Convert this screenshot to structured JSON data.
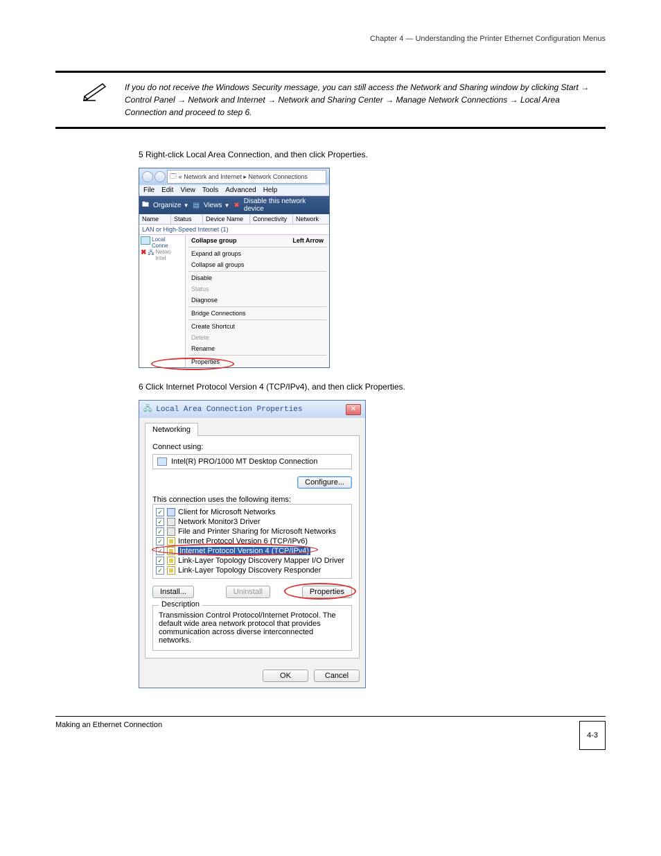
{
  "header": {
    "chapter_line": "Chapter 4 — Understanding the Printer Ethernet Configuration Menus"
  },
  "note": {
    "text": "If you do not receive the Windows Security message, you can still access the Network and Sharing window by clicking Start → Control Panel → Network and Internet → Network and Sharing Center → Manage Network Connections → Local Area Connection and proceed to step 6."
  },
  "step5": "5 Right-click Local Area Connection, and then click Properties.",
  "fig1": {
    "breadcrumb": "« Network and Internet  ▸  Network Connections",
    "menubar": [
      "File",
      "Edit",
      "View",
      "Tools",
      "Advanced",
      "Help"
    ],
    "toolbar": {
      "organize": "Organize",
      "views": "Views",
      "disable": "Disable this network device"
    },
    "columns": [
      "Name",
      "Status",
      "Device Name",
      "Connectivity",
      "Network"
    ],
    "group": "LAN or High-Speed Internet (1)",
    "conn_line1": "Local",
    "conn_line2": "Conne",
    "conn_line3": "Netwo",
    "conn_line4": "Intel",
    "ctx": {
      "collapse_group": "Collapse group",
      "shortcut": "Left Arrow",
      "expand_all": "Expand all groups",
      "collapse_all": "Collapse all groups",
      "disable": "Disable",
      "status": "Status",
      "diagnose": "Diagnose",
      "bridge": "Bridge Connections",
      "shortcut_item": "Create Shortcut",
      "delete": "Delete",
      "rename": "Rename",
      "properties": "Properties"
    }
  },
  "step6": "6 Click Internet Protocol Version 4 (TCP/IPv4), and then click Properties.",
  "fig2": {
    "title": "Local Area Connection Properties",
    "tab": "Networking",
    "connect_label": "Connect using:",
    "adapter": "Intel(R) PRO/1000 MT Desktop Connection",
    "configure": "Configure...",
    "uses_label": "This connection uses the following items:",
    "items": [
      "Client for Microsoft Networks",
      "Network Monitor3 Driver",
      "File and Printer Sharing for Microsoft Networks",
      "Internet Protocol Version 6 (TCP/IPv6)",
      "Internet Protocol Version 4 (TCP/IPv4)",
      "Link-Layer Topology Discovery Mapper I/O Driver",
      "Link-Layer Topology Discovery Responder"
    ],
    "install": "Install...",
    "uninstall": "Uninstall",
    "properties": "Properties",
    "desc_legend": "Description",
    "desc_text": "Transmission Control Protocol/Internet Protocol. The default wide area network protocol that provides communication across diverse interconnected networks.",
    "ok": "OK",
    "cancel": "Cancel"
  },
  "footer": {
    "left": "Making an Ethernet Connection",
    "page": "4-3"
  }
}
